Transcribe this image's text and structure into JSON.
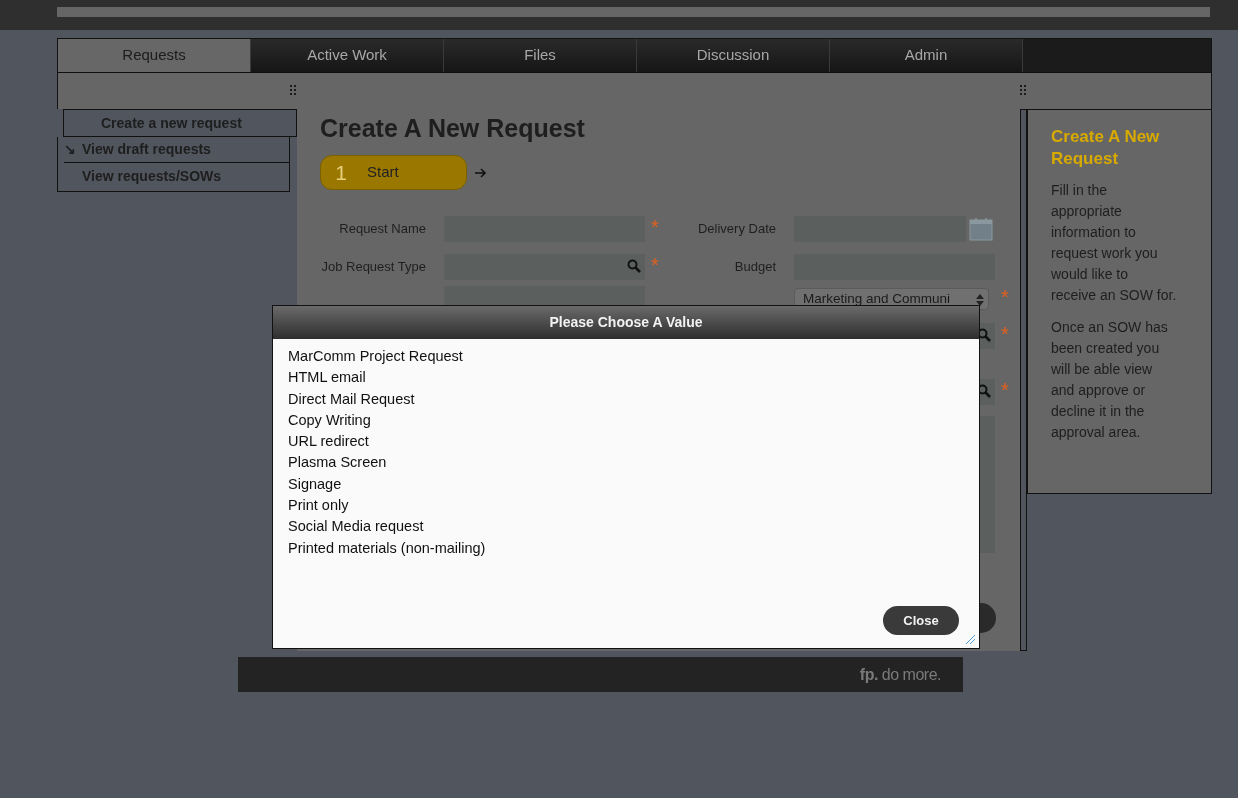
{
  "tabs": [
    {
      "label": "Requests",
      "selected": true
    },
    {
      "label": "Active Work",
      "selected": false
    },
    {
      "label": "Files",
      "selected": false
    },
    {
      "label": "Discussion",
      "selected": false
    },
    {
      "label": "Admin",
      "selected": false
    }
  ],
  "sidebar": {
    "items": [
      {
        "label": "Create a new request",
        "selected": true,
        "marker": ""
      },
      {
        "label": "View draft requests",
        "selected": false,
        "marker": "↘"
      },
      {
        "label": "View requests/SOWs",
        "selected": false,
        "marker": ""
      }
    ]
  },
  "main": {
    "heading": "Create A New Request",
    "steps": [
      {
        "number": "1",
        "label": "Start",
        "selected": true
      }
    ],
    "form": {
      "rows": [
        {
          "left": {
            "label": "Request Name",
            "kind": "text",
            "required_mark": "*"
          },
          "right": {
            "label": "Delivery Date",
            "kind": "date"
          }
        },
        {
          "left": {
            "label": "Job Request Type",
            "kind": "lookup",
            "required_mark": "*"
          },
          "right": {
            "label": "Budget",
            "kind": "text"
          }
        },
        {
          "left": {
            "kind": "text"
          },
          "right": {
            "kind": "select",
            "value": "Marketing and Communi",
            "required_mark": "*"
          }
        },
        {
          "right": {
            "kind": "lookup",
            "required_mark": "*"
          }
        },
        {
          "right": {
            "kind": "lookup",
            "required_mark": "*"
          }
        },
        {
          "right": {
            "kind": "textarea"
          }
        }
      ]
    }
  },
  "help": {
    "title": "Create A New Request",
    "paragraphs": [
      "Fill in the appropriate information to request work you would like to receive an SOW for.",
      "Once an SOW has been created you will be able view and approve or decline it in the approval area."
    ]
  },
  "footer": {
    "brand": "**fp.** do more."
  },
  "modal": {
    "title": "Please Choose A Value",
    "options": [
      "MarComm Project Request",
      "HTML email",
      "Direct Mail Request",
      "Copy Writing",
      "URL redirect",
      "Plasma Screen",
      "Signage",
      "Print only",
      "Social Media request",
      "Printed materials (non-mailing)"
    ],
    "close_button": "Close"
  }
}
